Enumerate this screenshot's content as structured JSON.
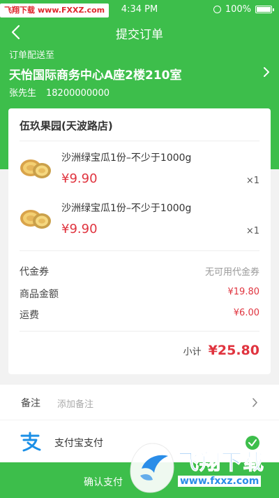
{
  "status_bar": {
    "watermark_site": "飞翔下载",
    "watermark_url": "www.FXXZ.com",
    "time": "4:34 PM",
    "battery": "100%"
  },
  "nav": {
    "title": "提交订单"
  },
  "address": {
    "label": "订单配送至",
    "line": "天怡国际商务中心A座2楼210室",
    "name": "张先生",
    "phone": "18200000000"
  },
  "order": {
    "store": "伍玖果园(天波路店)",
    "items": [
      {
        "name": "沙洲绿宝瓜1份–不少于1000g",
        "price": "¥9.90",
        "qty": "×1",
        "icon": "melon-icon"
      },
      {
        "name": "沙洲绿宝瓜1份–不少于1000g",
        "price": "¥9.90",
        "qty": "×1",
        "icon": "melon-icon"
      }
    ],
    "coupon_label": "代金券",
    "coupon_value": "无可用代金券",
    "goods_label": "商品金额",
    "goods_value": "¥19.80",
    "shipping_label": "运费",
    "shipping_value": "¥6.00",
    "subtotal_label": "小计",
    "subtotal_value": "¥25.80"
  },
  "remarks": {
    "label": "备注",
    "placeholder": "添加备注"
  },
  "payment": {
    "label": "支付宝支付",
    "icon": "alipay-icon",
    "selected": true
  },
  "confirm": {
    "label": "确认支付"
  },
  "watermark": {
    "title": "飞翔下载",
    "url": "www.fxxz.com"
  },
  "colors": {
    "brand_green": "#3dbe4b",
    "price_red": "#e0343f"
  }
}
